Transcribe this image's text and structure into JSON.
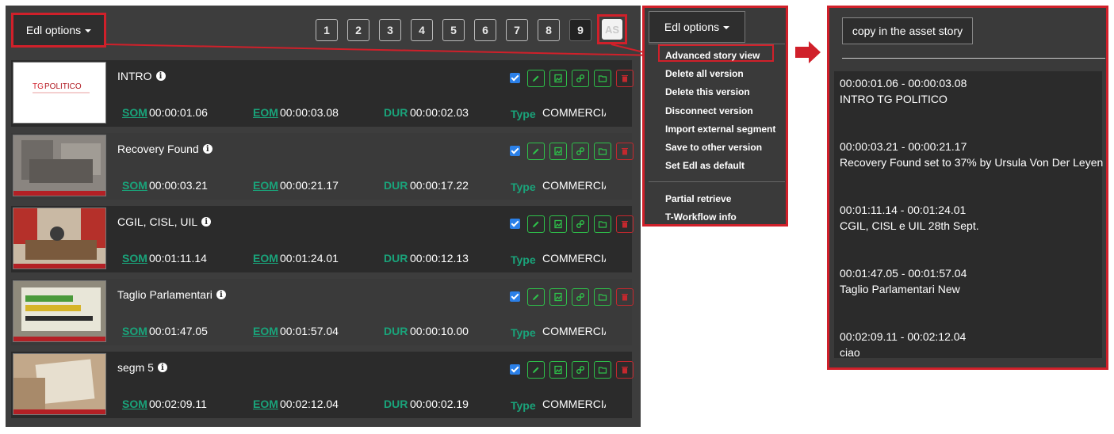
{
  "edl_options_label": "Edl options",
  "pages": [
    "1",
    "2",
    "3",
    "4",
    "5",
    "6",
    "7",
    "8",
    "9"
  ],
  "active_page": "9",
  "as_label": "AS",
  "labels": {
    "som": "SOM",
    "eom": "EOM",
    "dur": "DUR",
    "type": "Type"
  },
  "segments": [
    {
      "title": "INTRO",
      "som": "00:00:01.06",
      "eom": "00:00:03.08",
      "dur": "00:00:02.03",
      "type": "COMMERCIAL"
    },
    {
      "title": "Recovery Found",
      "som": "00:00:03.21",
      "eom": "00:00:21.17",
      "dur": "00:00:17.22",
      "type": "COMMERCIAL"
    },
    {
      "title": "CGIL, CISL, UIL",
      "som": "00:01:11.14",
      "eom": "00:01:24.01",
      "dur": "00:00:12.13",
      "type": "COMMERCIAL"
    },
    {
      "title": "Taglio Parlamentari",
      "som": "00:01:47.05",
      "eom": "00:01:57.04",
      "dur": "00:00:10.00",
      "type": "COMMERCIAL"
    },
    {
      "title": "segm 5",
      "som": "00:02:09.11",
      "eom": "00:02:12.04",
      "dur": "00:00:02.19",
      "type": "COMMERCIAL"
    }
  ],
  "thumbnail_text": {
    "intro_logo_a": "TG",
    "intro_logo_b": "POLITICO"
  },
  "menu": {
    "items": [
      "Advanced story view",
      "Delete all version",
      "Delete this version",
      "Disconnect version",
      "Import external segment",
      "Save to other version",
      "Set Edl as default"
    ],
    "items2": [
      "Partial retrieve",
      "T-Workflow info"
    ]
  },
  "copy_button_label": "copy in the asset story",
  "story": [
    {
      "tc": "00:00:01.06 - 00:00:03.08",
      "text": "INTRO TG POLITICO"
    },
    {
      "tc": "00:00:03.21 - 00:00:21.17",
      "text": "Recovery Found set to 37% by Ursula Von Der Leyen"
    },
    {
      "tc": "00:01:11.14 - 00:01:24.01",
      "text": "CGIL, CISL e UIL 28th Sept."
    },
    {
      "tc": "00:01:47.05 - 00:01:57.04",
      "text": "Taglio Parlamentari New"
    },
    {
      "tc": "00:02:09.11 - 00:02:12.04",
      "text": "ciao"
    }
  ],
  "colors": {
    "highlight_red": "#d0202a",
    "timecode_green": "#1aa37a",
    "action_green": "#2ec24a",
    "delete_red": "#c4282e"
  }
}
